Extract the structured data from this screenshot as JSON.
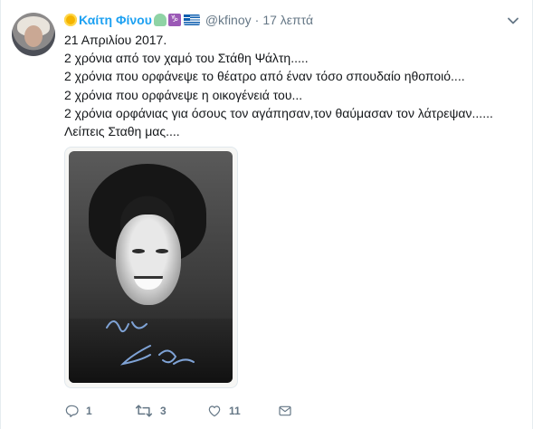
{
  "tweet": {
    "display_name": "Καίτη Φίνου",
    "handle": "@kfinoy",
    "separator": "·",
    "time": "17 λεπτά",
    "lines": [
      "21 Απριλίου 2017.",
      "2 χρόνια από τον χαμό του Στάθη Ψάλτη.....",
      "2 χρόνια που ορφάνεψε το θέατρο από έναν τόσο σπουδαίο ηθοποιό....",
      "2 χρόνια που ορφάνεψε η οικογένειά του...",
      "2 χρόνια ορφάνιας για όσους τον αγάπησαν,τον θαύμασαν τον λάτρεψαν......",
      "Λείπεις Σταθη μας...."
    ],
    "actions": {
      "reply_count": "1",
      "retweet_count": "3",
      "like_count": "11"
    }
  },
  "icons": {
    "name_prefix": "sun-icon",
    "name_suffix": [
      "heart-icon",
      "capricorn-icon",
      "greek-flag-icon"
    ],
    "menu": "chevron-down-icon",
    "reply": "reply-icon",
    "retweet": "retweet-icon",
    "like": "heart-outline-icon",
    "dm": "envelope-icon"
  },
  "colors": {
    "accent": "#1da1f2",
    "secondary_text": "#657786",
    "text": "#14171a"
  }
}
